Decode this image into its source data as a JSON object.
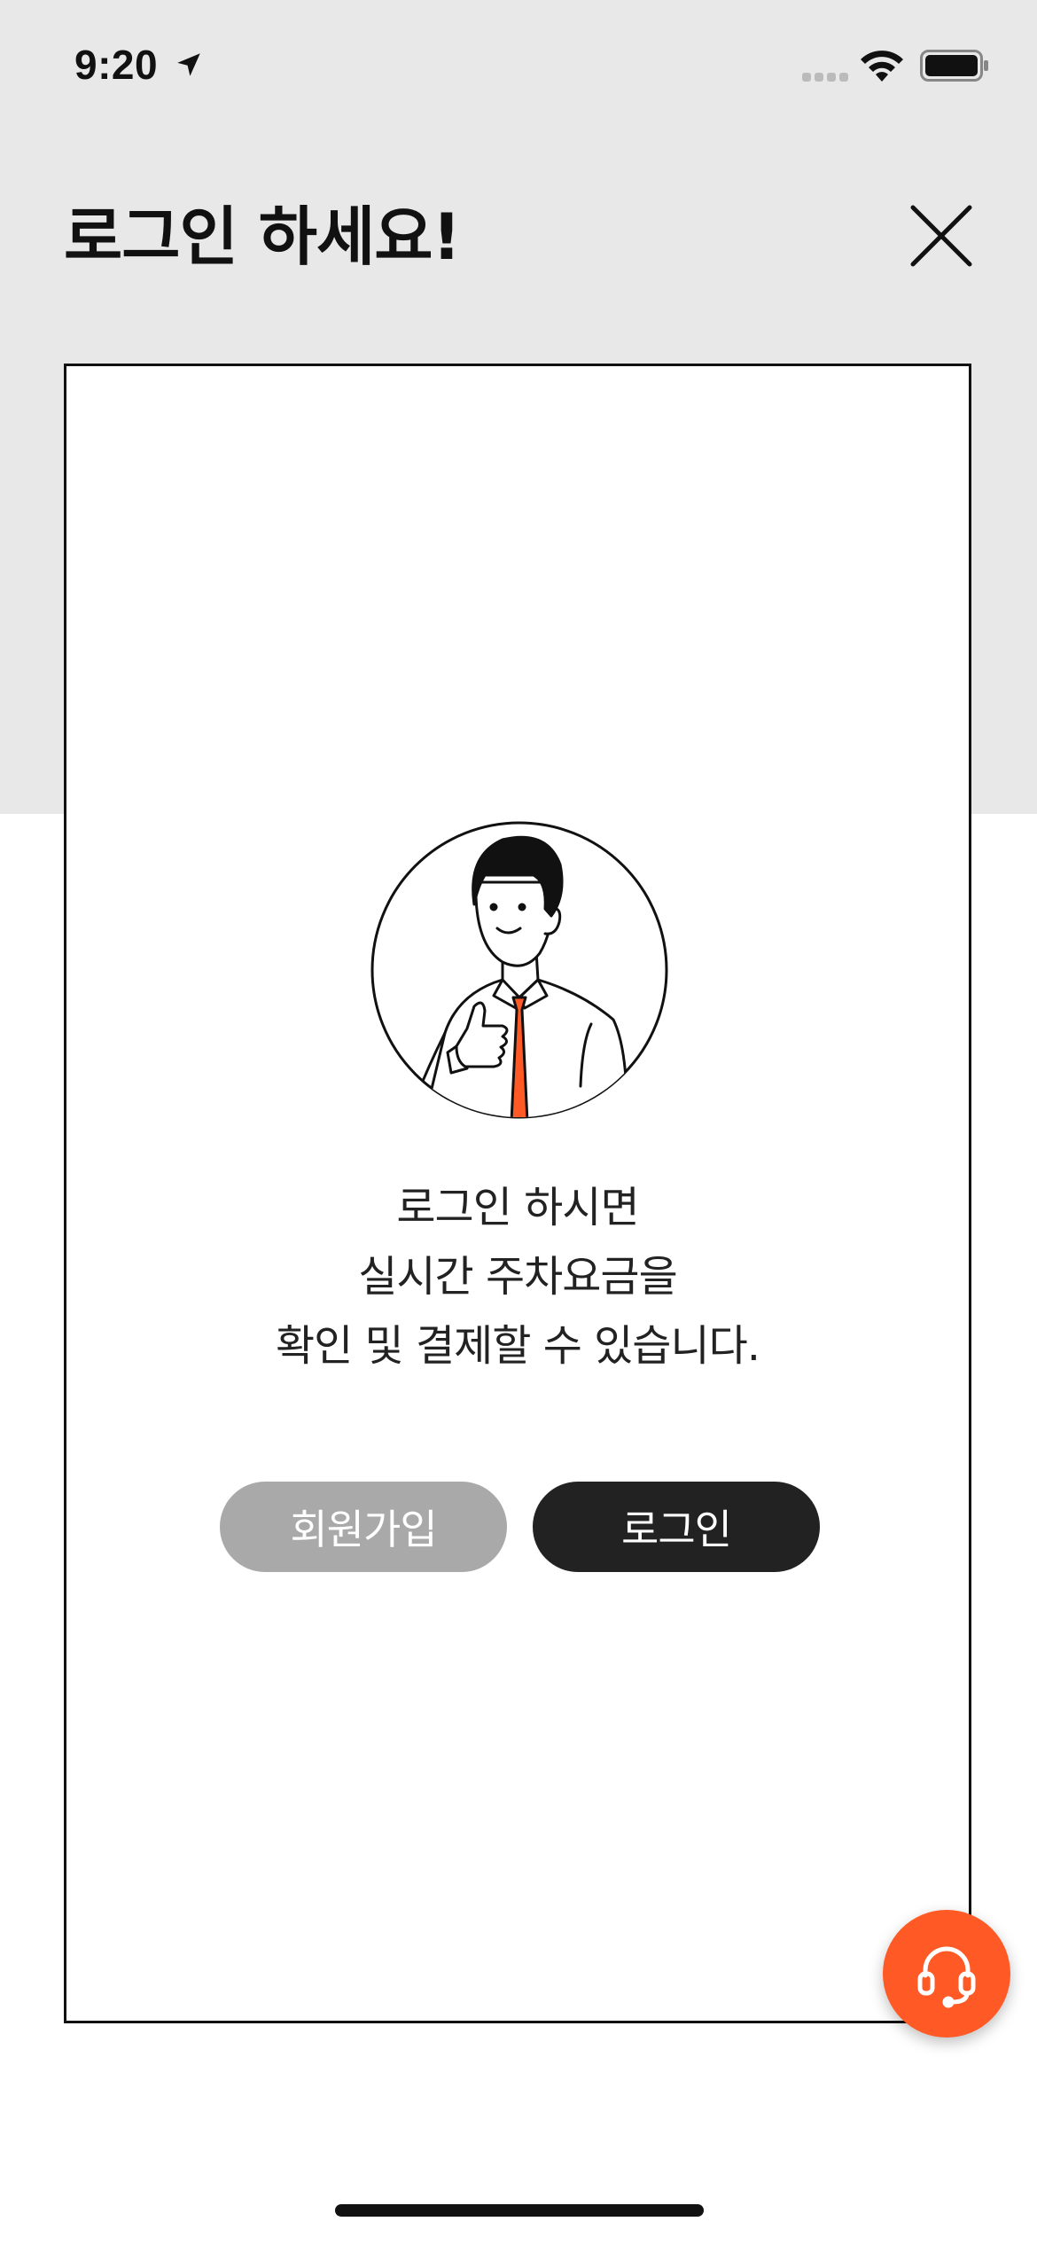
{
  "status_bar": {
    "time": "9:20",
    "location_icon": "location-arrow-icon",
    "signal_icon": "cellular-signal-icon",
    "wifi_icon": "wifi-icon",
    "battery_icon": "battery-icon"
  },
  "header": {
    "title": "로그인 하세요!",
    "close_icon": "close-icon"
  },
  "card": {
    "illustration": "thumbs-up-man-avatar",
    "message_lines": [
      "로그인 하시면",
      "실시간 주차요금을",
      "확인 및 결제할 수 있습니다."
    ],
    "signup_label": "회원가입",
    "login_label": "로그인"
  },
  "support": {
    "icon": "headset-icon"
  },
  "colors": {
    "top_background": "#e8e8e8",
    "accent": "#ff5a26",
    "signup_button": "#a9a9a9",
    "login_button": "#222222"
  }
}
